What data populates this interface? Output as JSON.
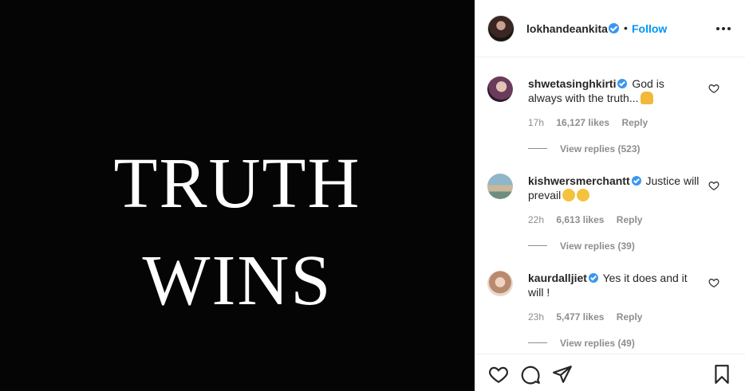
{
  "post": {
    "line1": "TRUTH",
    "line2": "WINS"
  },
  "header": {
    "username": "lokhandeankita",
    "separator": "•",
    "follow_label": "Follow"
  },
  "comments": [
    {
      "username": "shwetasinghkirti",
      "text": "God is always with the truth...",
      "time": "17h",
      "likes": "16,127 likes",
      "reply": "Reply",
      "view_replies": "View replies (523)"
    },
    {
      "username": "kishwersmerchantt",
      "text": "Justice will prevail",
      "time": "22h",
      "likes": "6,613 likes",
      "reply": "Reply",
      "view_replies": "View replies (39)"
    },
    {
      "username": "kaurdalljiet",
      "text": "Yes it does and it will !",
      "time": "23h",
      "likes": "5,477 likes",
      "reply": "Reply",
      "view_replies": "View replies (49)"
    }
  ],
  "icons": {
    "like": "heart-icon",
    "comment": "comment-icon",
    "share": "share-icon",
    "save": "bookmark-icon",
    "more": "more-icon"
  },
  "colors": {
    "accent": "#0095f6",
    "verified": "#3897f0",
    "image_bg": "#050505"
  }
}
